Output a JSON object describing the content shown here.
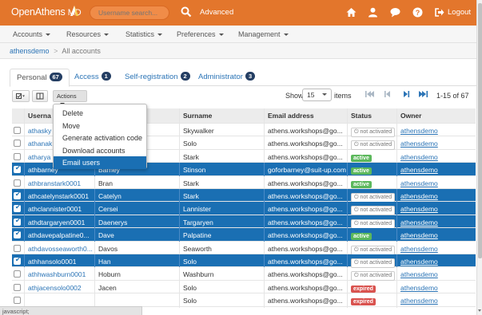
{
  "brand": {
    "name": "OpenAthens",
    "suffix": "MD"
  },
  "search": {
    "placeholder": "Username search..."
  },
  "topnav": {
    "advanced_label": "Advanced",
    "logout_label": "Logout"
  },
  "icons": [
    "home-icon",
    "user-icon",
    "chat-icon",
    "help-icon",
    "logout-icon",
    "search-icon"
  ],
  "menu": [
    {
      "label": "Accounts"
    },
    {
      "label": "Resources"
    },
    {
      "label": "Statistics"
    },
    {
      "label": "Preferences"
    },
    {
      "label": "Management"
    }
  ],
  "breadcrumb": {
    "root": "athensdemo",
    "separator": ">",
    "current": "All accounts"
  },
  "tabs": [
    {
      "label": "Personal",
      "count": "67"
    },
    {
      "label": "Access",
      "count": "1"
    },
    {
      "label": "Self-registration",
      "count": "2"
    },
    {
      "label": "Administrator",
      "count": "3"
    }
  ],
  "toolbar": {
    "actions_label": "Actions"
  },
  "pagination": {
    "show_label": "Show",
    "page_size": "15",
    "items_label": "items",
    "range": "1-15 of 67"
  },
  "actions_menu": [
    "Delete",
    "Move",
    "Generate activation code",
    "Download accounts",
    "Email users"
  ],
  "table": {
    "columns": [
      "Userna",
      "",
      "Surname",
      "Email address",
      "Status",
      "Owner"
    ],
    "rows": [
      {
        "username": "athasky",
        "first": "",
        "surname": "Skywalker",
        "email": "athens.workshops@go...",
        "status": "not activated",
        "owner": "athensdemo",
        "selected": false
      },
      {
        "username": "athanak",
        "first": "",
        "surname": "Solo",
        "email": "athens.workshops@go...",
        "status": "not activated",
        "owner": "athensdemo",
        "selected": false
      },
      {
        "username": "atharya",
        "first": "",
        "surname": "Stark",
        "email": "athens.workshops@go...",
        "status": "active",
        "owner": "athensdemo",
        "selected": false
      },
      {
        "username": "athbarney",
        "first": "Barney",
        "surname": "Stinson",
        "email": "goforbarney@suit-up.com",
        "status": "active",
        "owner": "athensdemo",
        "selected": true
      },
      {
        "username": "athbranstark0001",
        "first": "Bran",
        "surname": "Stark",
        "email": "athens.workshops@go...",
        "status": "active",
        "owner": "athensdemo",
        "selected": false
      },
      {
        "username": "athcatelynstark0001",
        "first": "Catelyn",
        "surname": "Stark",
        "email": "athens.workshops@go...",
        "status": "not activated",
        "owner": "athensdemo",
        "selected": true
      },
      {
        "username": "athclannister0001",
        "first": "Cersei",
        "surname": "Lannister",
        "email": "athens.workshops@go...",
        "status": "not activated",
        "owner": "athensdemo",
        "selected": true
      },
      {
        "username": "athdtargaryen0001",
        "first": "Daenerys",
        "surname": "Targaryen",
        "email": "athens.workshops@go...",
        "status": "not activated",
        "owner": "athensdemo",
        "selected": true
      },
      {
        "username": "athdavepalpatine0...",
        "first": "Dave",
        "surname": "Palpatine",
        "email": "athens.workshops@go...",
        "status": "active",
        "owner": "athensdemo",
        "selected": true
      },
      {
        "username": "athdavosseaworth0...",
        "first": "Davos",
        "surname": "Seaworth",
        "email": "athens.workshops@go...",
        "status": "not activated",
        "owner": "athensdemo",
        "selected": false
      },
      {
        "username": "athhansolo0001",
        "first": "Han",
        "surname": "Solo",
        "email": "athens.workshops@go...",
        "status": "not activated",
        "owner": "athensdemo",
        "selected": true
      },
      {
        "username": "athhwashburn0001",
        "first": "Hoburn",
        "surname": "Washburn",
        "email": "athens.workshops@go...",
        "status": "not activated",
        "owner": "athensdemo",
        "selected": false
      },
      {
        "username": "athjacensolo0002",
        "first": "Jacen",
        "surname": "Solo",
        "email": "athens.workshops@go...",
        "status": "expired",
        "owner": "athensdemo",
        "selected": false
      },
      {
        "username": "",
        "first": "",
        "surname": "Solo",
        "email": "athens.workshops@go...",
        "status": "expired",
        "owner": "athensdemo",
        "selected": false
      }
    ]
  },
  "statusbar": {
    "text": "javascript;"
  },
  "colors": {
    "brand_orange": "#e3762c",
    "selection_blue": "#1a6fb3",
    "link_blue": "#2b74b6",
    "badge_navy": "#243e63",
    "active_green": "#5cb85c",
    "expired_red": "#d9534f"
  }
}
